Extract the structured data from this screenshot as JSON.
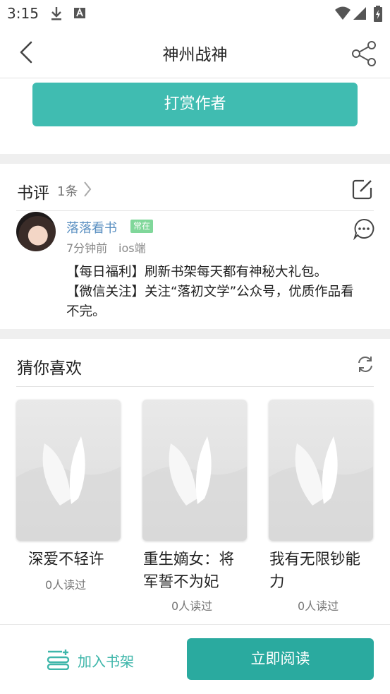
{
  "status_bar": {
    "time": "3:15"
  },
  "nav": {
    "title": "神州战神"
  },
  "reward_button": "打赏作者",
  "reviews": {
    "title": "书评",
    "count": "1条",
    "items": [
      {
        "username": "落落看书",
        "badge": "常在",
        "time": "7分钟前",
        "source": "ios端",
        "lines": [
          "【每日福利】刷新书架每天都有神秘大礼包。",
          "【微信关注】关注“落初文学”公众号，优质作品看",
          "不完。"
        ]
      }
    ]
  },
  "recommend": {
    "title": "猜你喜欢",
    "books": [
      {
        "title_lines": [
          "深爱不轻许"
        ],
        "reads": "0人读过"
      },
      {
        "title_lines": [
          "重生嫡女：将",
          "军誓不为妃"
        ],
        "reads": "0人读过"
      },
      {
        "title_lines": [
          "我有无限钞能",
          "力"
        ],
        "reads": "0人读过"
      }
    ]
  },
  "bottom": {
    "shelf_label": "加入书架",
    "read_label": "立即阅读"
  },
  "colors": {
    "accent": "#40bcb1",
    "read_button": "#2aaa9f",
    "username": "#5a8fc1",
    "badge": "#80d79a"
  }
}
